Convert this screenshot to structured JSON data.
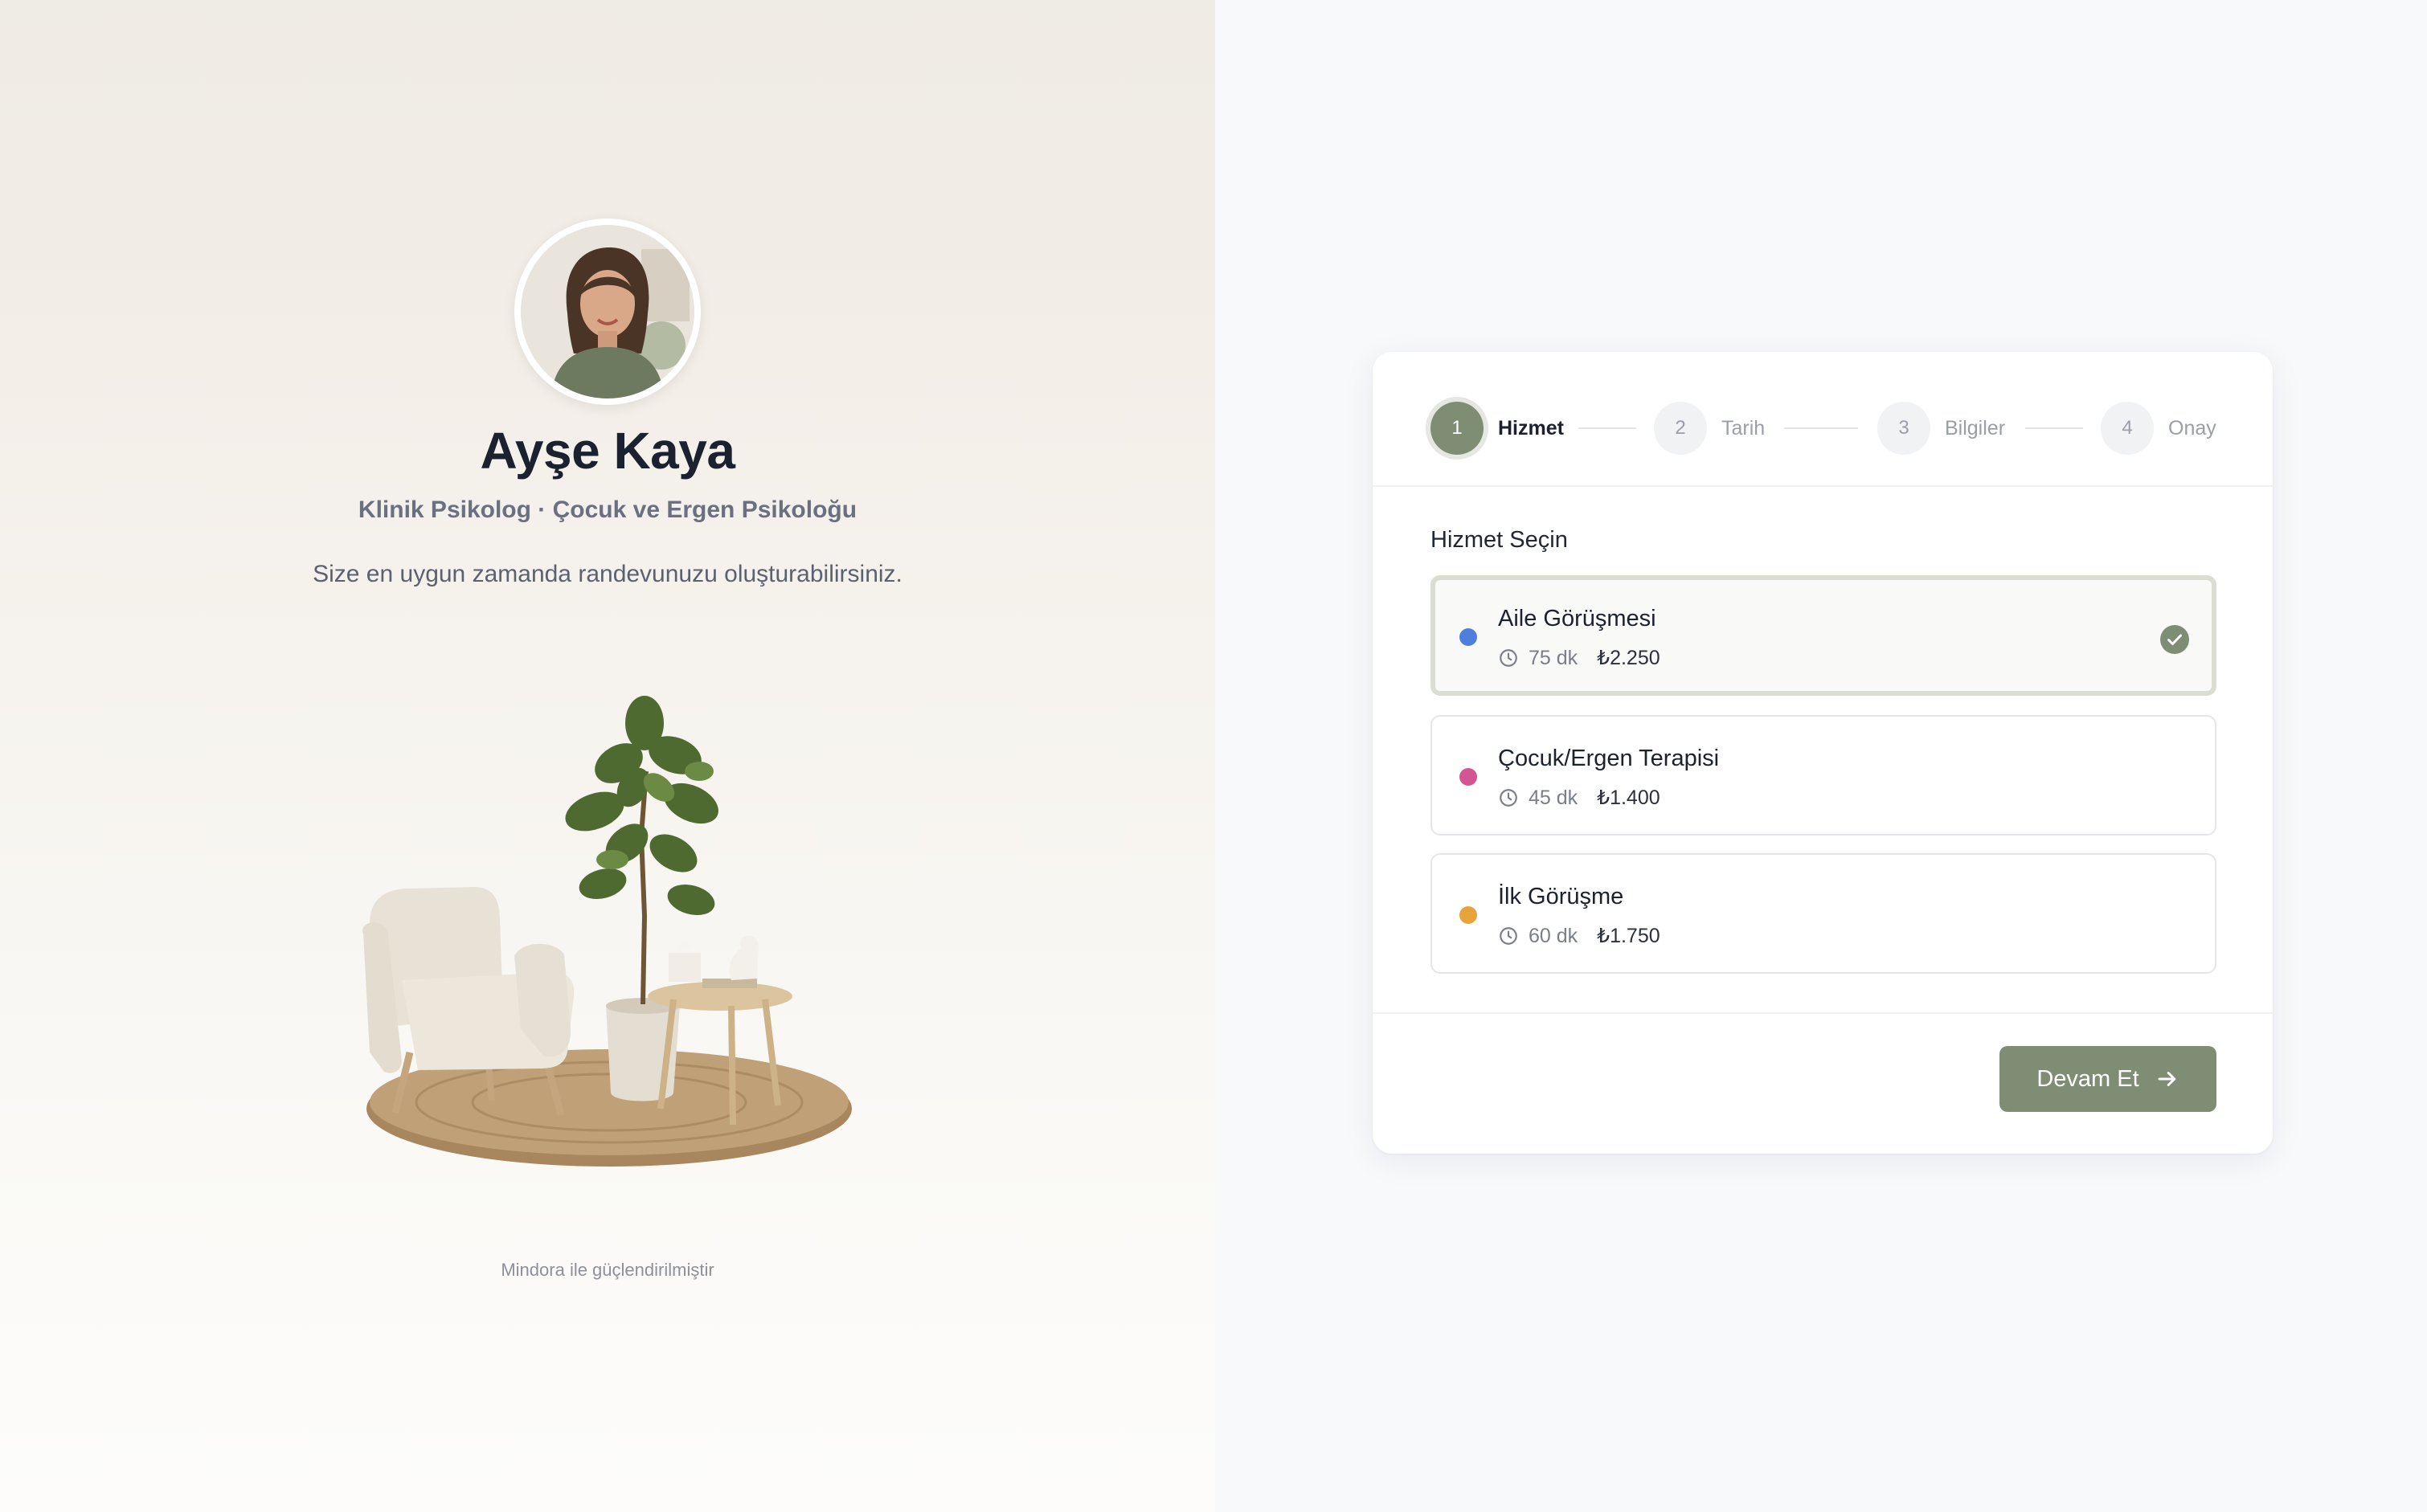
{
  "profile": {
    "name": "Ayşe Kaya",
    "subtitle": "Klinik Psikolog · Çocuk ve Ergen Psikoloğu",
    "tagline": "Size en uygun zamanda randevunuzu oluşturabilirsiniz.",
    "powered_by": "Mindora ile güçlendirilmiştir"
  },
  "steps": [
    {
      "number": "1",
      "label": "Hizmet",
      "active": true
    },
    {
      "number": "2",
      "label": "Tarih",
      "active": false
    },
    {
      "number": "3",
      "label": "Bilgiler",
      "active": false
    },
    {
      "number": "4",
      "label": "Onay",
      "active": false
    }
  ],
  "section_title": "Hizmet Seçin",
  "services": [
    {
      "title": "Aile Görüşmesi",
      "duration": "75 dk",
      "price": "₺2.250",
      "color": "#4f7fdc",
      "selected": true
    },
    {
      "title": "Çocuk/Ergen Terapisi",
      "duration": "45 dk",
      "price": "₺1.400",
      "color": "#d45592",
      "selected": false
    },
    {
      "title": "İlk Görüşme",
      "duration": "60 dk",
      "price": "₺1.750",
      "color": "#e8a33a",
      "selected": false
    }
  ],
  "continue_label": "Devam Et",
  "colors": {
    "accent": "#7f8d74",
    "accent_ring": "#e5e8e0"
  }
}
